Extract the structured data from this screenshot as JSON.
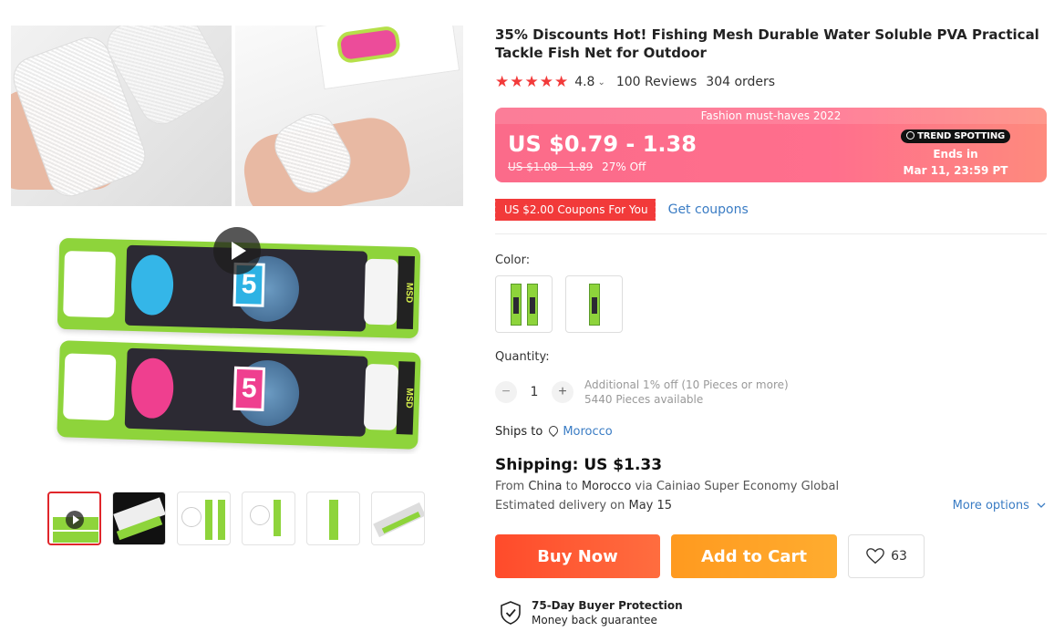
{
  "product": {
    "title": "35% Discounts Hot! Fishing Mesh Durable Water Soluble PVA Practical Tackle Fish Net for Outdoor"
  },
  "gallery": {
    "tube1_number": "5",
    "tube2_number": "5",
    "brand_mark": "MSD"
  },
  "rating": {
    "stars": "★★★★★",
    "value": "4.8",
    "reviews": "100 Reviews",
    "orders": "304 orders"
  },
  "price": {
    "banner_label": "Fashion must-haves 2022",
    "current": "US $0.79 - 1.38",
    "original": "US $1.08 - 1.89",
    "discount": "27% Off",
    "badge": "TREND SPOTTING",
    "ends_label": "Ends in",
    "ends_time": "Mar 11, 23:59 PT"
  },
  "coupon": {
    "tag": "US $2.00 Coupons For You",
    "link": "Get coupons"
  },
  "color": {
    "label": "Color:"
  },
  "quantity": {
    "label": "Quantity:",
    "value": "1",
    "minus": "−",
    "plus": "+",
    "note_line1": "Additional 1% off (10 Pieces or more)",
    "note_line2": "5440 Pieces available"
  },
  "shipping": {
    "ships_to_label": "Ships to",
    "country": "Morocco",
    "title": "Shipping: US $1.33",
    "from_prefix": "From",
    "from_country": "China",
    "to_prefix": "to",
    "to_country": "Morocco",
    "via": "via Cainiao Super Economy Global",
    "delivery_prefix": "Estimated delivery on",
    "delivery_date": "May 15",
    "more_options": "More options"
  },
  "actions": {
    "buy_now": "Buy Now",
    "add_to_cart": "Add to Cart",
    "wishlist_count": "63"
  },
  "protection": {
    "title": "75-Day Buyer Protection",
    "subtitle": "Money back guarantee"
  },
  "colors": {
    "accent_red": "#f23a3a",
    "banner_pink": "#fb6b8a",
    "buy_now": "#ff4b2b",
    "add_cart": "#ff9a1f",
    "link_blue": "#3a7cc4"
  }
}
